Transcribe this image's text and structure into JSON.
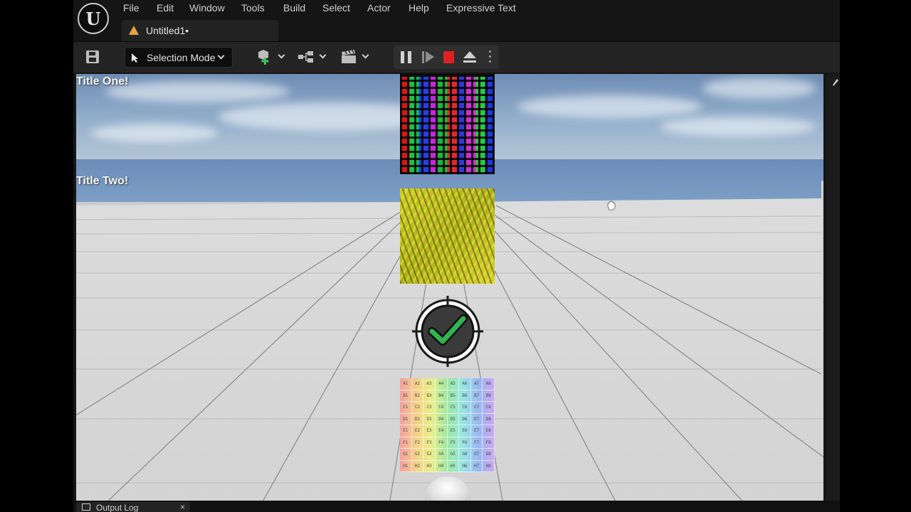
{
  "app": {
    "tab_title": "Untitled1•"
  },
  "menu": {
    "items": [
      "File",
      "Edit",
      "Window",
      "Tools",
      "Build",
      "Select",
      "Actor",
      "Help",
      "Expressive Text"
    ]
  },
  "toolbar": {
    "mode_label": "Selection Mode"
  },
  "viewport": {
    "title_one": "Title One!",
    "title_two": "Title Two!",
    "grid_cells": [
      "A1",
      "A2",
      "A3",
      "A4",
      "A5",
      "A6",
      "A7",
      "A8",
      "B1",
      "B2",
      "B3",
      "B4",
      "B5",
      "B6",
      "B7",
      "B8",
      "C1",
      "C2",
      "C3",
      "C4",
      "C5",
      "C6",
      "C7",
      "C8",
      "D1",
      "D2",
      "D3",
      "D4",
      "D5",
      "D6",
      "D7",
      "D8",
      "E1",
      "E2",
      "E3",
      "E4",
      "E5",
      "E6",
      "E7",
      "E8",
      "F1",
      "F2",
      "F3",
      "F4",
      "F5",
      "F6",
      "F7",
      "F8",
      "G1",
      "G2",
      "G3",
      "G4",
      "G5",
      "G6",
      "G7",
      "G8",
      "H1",
      "H2",
      "H3",
      "H4",
      "H5",
      "H6",
      "H7",
      "H8"
    ]
  },
  "bottom": {
    "output_tab_label": "Output Log",
    "close_glyph": "×"
  },
  "colors": {
    "accent_stop": "#e02020",
    "tab_warning": "#e8a33a",
    "check_green": "#2fb44f"
  }
}
